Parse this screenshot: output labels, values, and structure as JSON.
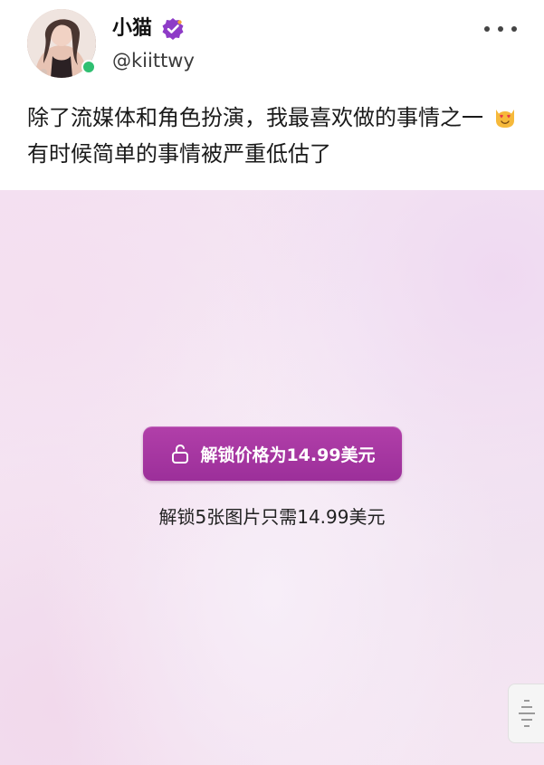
{
  "user": {
    "name": "小猫",
    "handle": "@kiittwy",
    "verified_color": "#8e3bc7",
    "online_color": "#2fbf71"
  },
  "post": {
    "line1": "除了流媒体和角色扮演，我最喜欢做的事情之一",
    "emoji": "smiling-cat-heart-eyes-emoji",
    "line2": "有时候简单的事情被严重低估了"
  },
  "media": {
    "unlock_button_label": "解锁价格为14.99美元",
    "unlock_note": "解锁5张图片只需14.99美元",
    "button_color": "#a8389f"
  },
  "icons": {
    "more": "more-horizontal-icon",
    "lock": "unlock-icon",
    "verified": "verified-badge-icon",
    "scroll": "scroll-handle-icon"
  }
}
